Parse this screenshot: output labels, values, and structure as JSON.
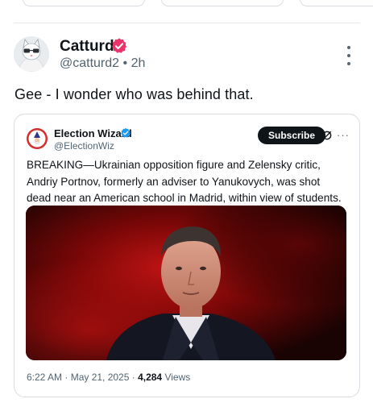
{
  "post": {
    "author_name": "Catturd",
    "handle": "@catturd2",
    "separator": "•",
    "time": "2h",
    "text": "Gee - I wonder who was behind that."
  },
  "quoted": {
    "author_name": "Election Wizard",
    "handle": "@ElectionWiz",
    "subscribe_label": "Subscribe",
    "more_label": "···",
    "text": "BREAKING—Ukrainian opposition figure and Zelensky critic, Andriy Portnov, formerly an adviser to Yanukovych, was shot dead near an American school in Madrid, within view of students.",
    "timestamp": "6:22 AM · May 21, 2025 · ",
    "views_count": "4,284",
    "views_label": " Views"
  },
  "icons": {
    "author_badge": "verified-badge-icon",
    "quoted_badge": "verified-badge-icon",
    "menu": "more-vertical-icon",
    "grok": "grok-icon"
  },
  "colors": {
    "verified_red": "#e8356b",
    "verified_blue": "#1d9bf0",
    "subscribe_bg": "#0f1419",
    "muted_text": "#536471"
  }
}
